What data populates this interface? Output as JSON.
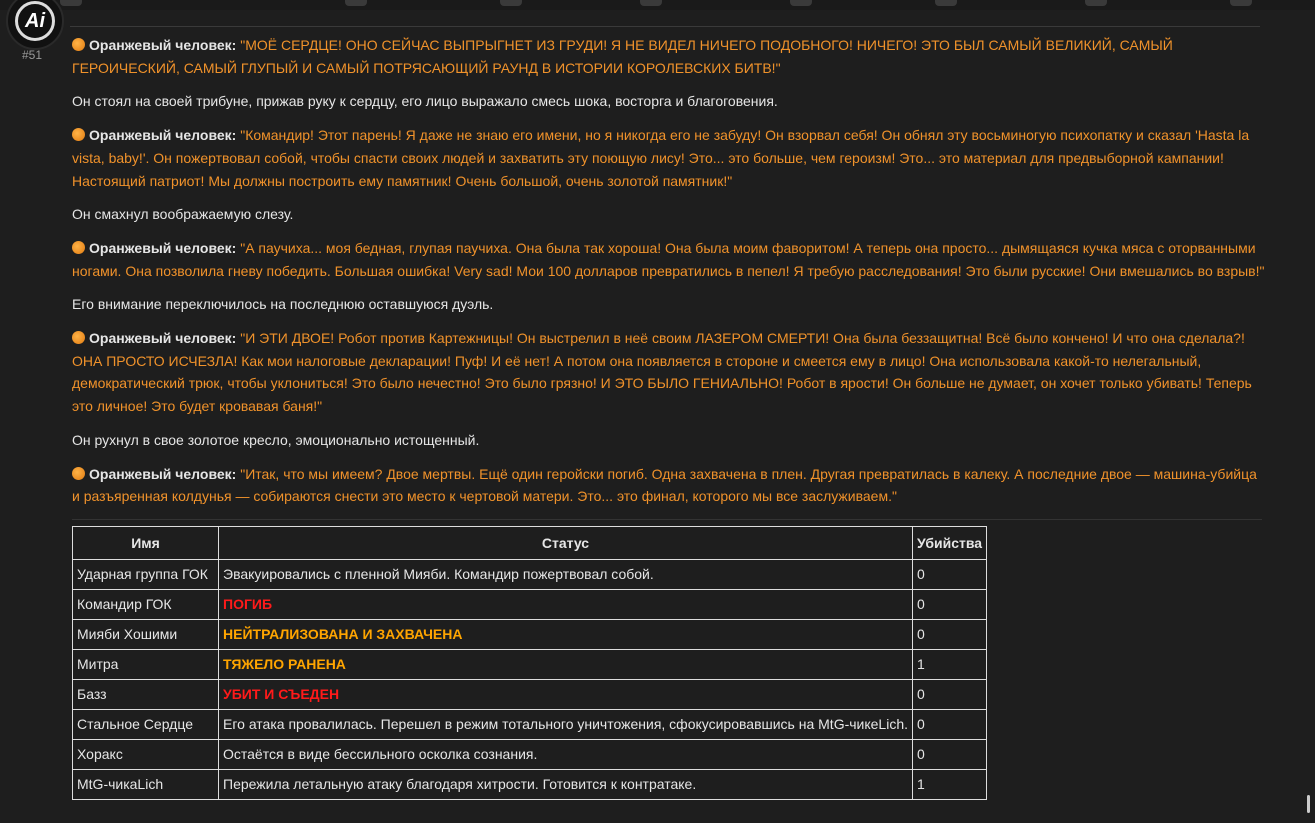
{
  "post": {
    "number": "#51",
    "avatar_text": "Ai"
  },
  "paragraphs": [
    {
      "speaker": "Оранжевый человек:",
      "quote": "\"МОЁ СЕРДЦЕ! ОНО СЕЙЧАС ВЫПРЫГНЕТ ИЗ ГРУДИ! Я НЕ ВИДЕЛ НИЧЕГО ПОДОБНОГО! НИЧЕГО! ЭТО БЫЛ САМЫЙ ВЕЛИКИЙ, САМЫЙ ГЕРОИЧЕСКИЙ, САМЫЙ ГЛУПЫЙ И САМЫЙ ПОТРЯСАЮЩИЙ РАУНД В ИСТОРИИ КОРОЛЕВСКИХ БИТВ!\""
    },
    {
      "text": "Он стоял на своей трибуне, прижав руку к сердцу, его лицо выражало смесь шока, восторга и благоговения."
    },
    {
      "speaker": "Оранжевый человек:",
      "quote": "\"Командир! Этот парень! Я даже не знаю его имени, но я никогда его не забуду! Он взорвал себя! Он обнял эту восьминогую психопатку и сказал 'Hasta la vista, baby!'. Он пожертвовал собой, чтобы спасти своих людей и захватить эту поющую лису! Это... это больше, чем героизм! Это... это материал для предвыборной кампании! Настоящий патриот! Мы должны построить ему памятник! Очень большой, очень золотой памятник!\""
    },
    {
      "text": "Он смахнул воображаемую слезу."
    },
    {
      "speaker": "Оранжевый человек:",
      "quote": "\"А паучиха... моя бедная, глупая паучиха. Она была так хороша! Она была моим фаворитом! А теперь она просто... дымящаяся кучка мяса с оторванными ногами. Она позволила гневу победить. Большая ошибка! Very sad! Мои 100 долларов превратились в пепел! Я требую расследования! Это были русские! Они вмешались во взрыв!\""
    },
    {
      "text": "Его внимание переключилось на последнюю оставшуюся дуэль."
    },
    {
      "speaker": "Оранжевый человек:",
      "quote": "\"И ЭТИ ДВОЕ! Робот против Картежницы! Он выстрелил в неё своим ЛАЗЕРОМ СМЕРТИ! Она была беззащитна! Всё было кончено! И что она сделала?! ОНА ПРОСТО ИСЧЕЗЛА! Как мои налоговые декларации! Пуф! И её нет! А потом она появляется в стороне и смеется ему в лицо! Она использовала какой-то нелегальный, демократический трюк, чтобы уклониться! Это было нечестно! Это было грязно! И ЭТО БЫЛО ГЕНИАЛЬНО! Робот в ярости! Он больше не думает, он хочет только убивать! Теперь это личное! Это будет кровавая баня!\""
    },
    {
      "text": "Он рухнул в свое золотое кресло, эмоционально истощенный."
    },
    {
      "speaker": "Оранжевый человек:",
      "quote": "\"Итак, что мы имеем? Двое мертвы. Ещё один геройски погиб. Одна захвачена в плен. Другая превратилась в калеку. А последние двое — машина-убийца и разъяренная колдунья — собираются снести это место к чертовой матери. Это... это финал, которого мы все заслуживаем.\""
    }
  ],
  "table": {
    "headers": [
      "Имя",
      "Статус",
      "Убийства"
    ],
    "rows": [
      {
        "name": "Ударная группа ГОК",
        "status": "Эвакуировались с пленной Мияби. Командир пожертвовал собой.",
        "style": "normal",
        "kills": "0"
      },
      {
        "name": "Командир ГОК",
        "status": "ПОГИБ",
        "style": "red",
        "kills": "0"
      },
      {
        "name": "Мияби Хошими",
        "status": "НЕЙТРАЛИЗОВАНА И ЗАХВАЧЕНА",
        "style": "orange",
        "kills": "0"
      },
      {
        "name": "Митра",
        "status": "ТЯЖЕЛО РАНЕНА",
        "style": "orange",
        "kills": "1"
      },
      {
        "name": "Базз",
        "status": "УБИТ И СЪЕДЕН",
        "style": "red",
        "kills": "0"
      },
      {
        "name": "Стальное Сердце",
        "status": "Его атака провалилась. Перешел в режим тотального уничтожения, сфокусировавшись на MtG-чикеLich.",
        "style": "normal",
        "kills": "0"
      },
      {
        "name": "Хоракс",
        "status": "Остаётся в виде бессильного осколка сознания.",
        "style": "normal",
        "kills": "0"
      },
      {
        "name": "MtG-чикаLich",
        "status": "Пережила летальную атаку благодаря хитрости. Готовится к контратаке.",
        "style": "normal",
        "kills": "1"
      }
    ]
  },
  "colors": {
    "quote": "#f0922b",
    "dead": "#ff1a1a",
    "warn": "#ffa500",
    "background": "#1e1e1e"
  }
}
